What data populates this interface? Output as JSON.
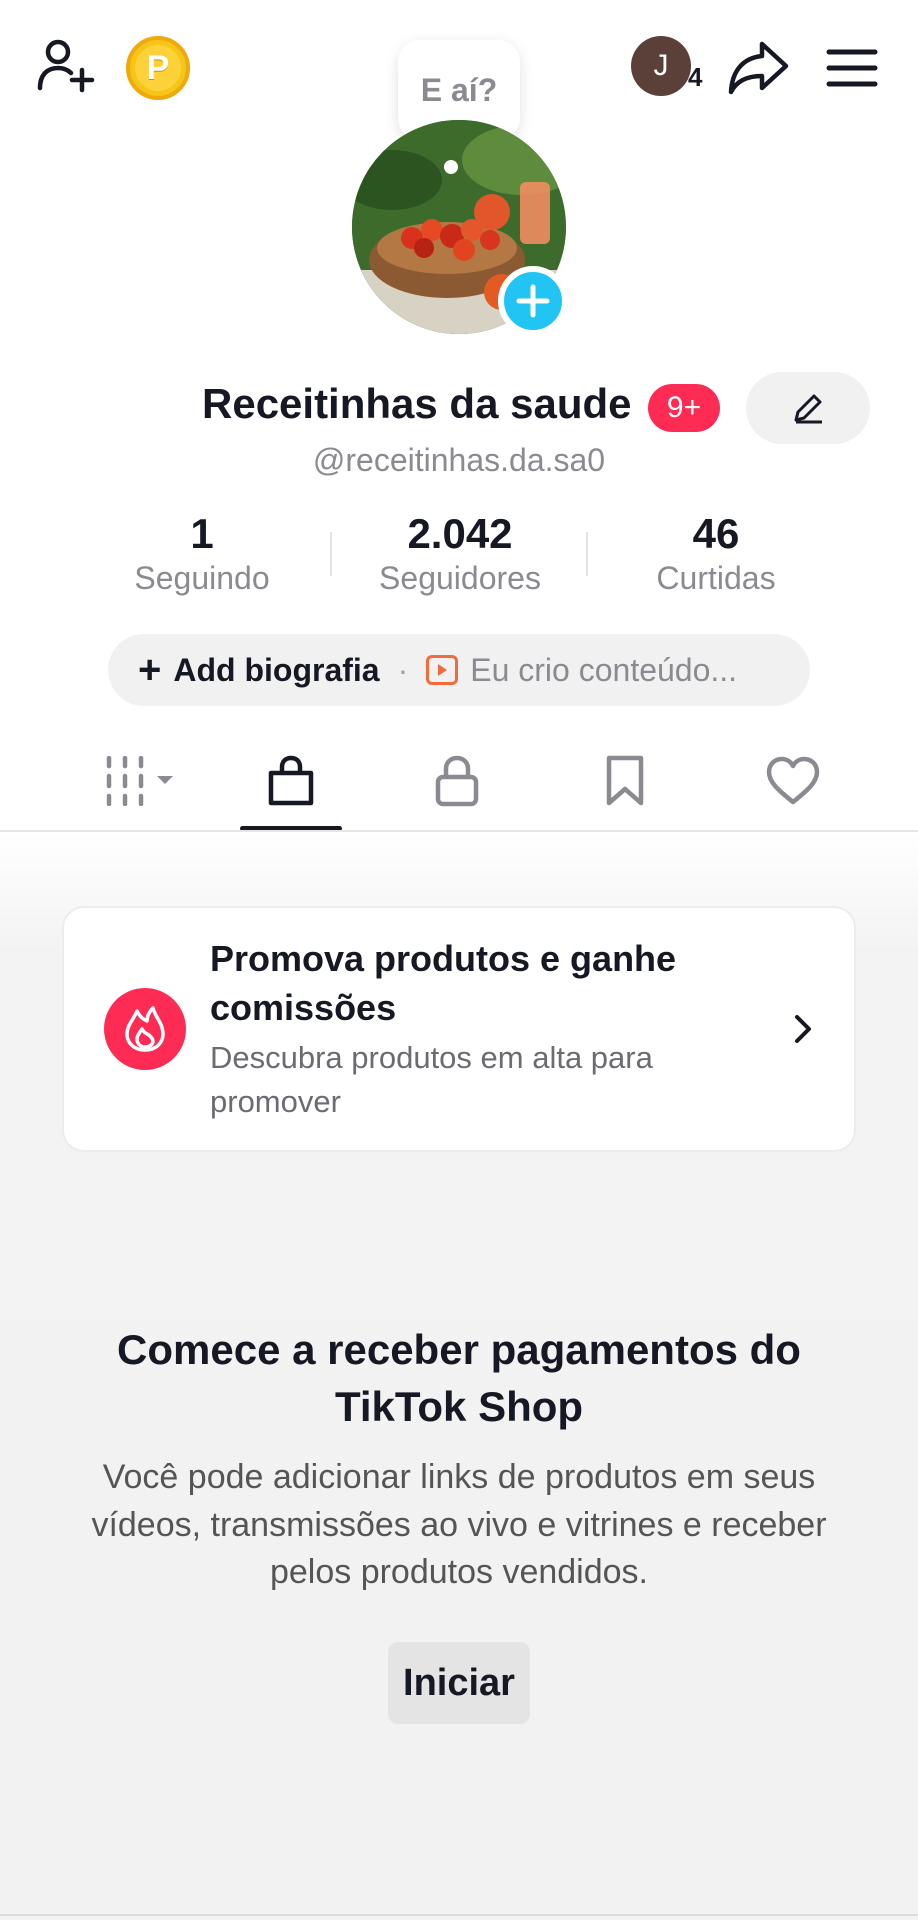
{
  "header": {
    "bubble_text": "E aí?",
    "coin_letter": "P",
    "avatar_letter": "J",
    "avatar_count": "4"
  },
  "profile": {
    "display_name": "Receitinhas da saude",
    "badge": "9+",
    "username": "@receitinhas.da.sa0"
  },
  "stats": {
    "following": {
      "value": "1",
      "label": "Seguindo"
    },
    "followers": {
      "value": "2.042",
      "label": "Seguidores"
    },
    "likes": {
      "value": "46",
      "label": "Curtidas"
    }
  },
  "bio": {
    "add_label": "Add biografia",
    "separator": "·",
    "creator_label": "Eu crio conteúdo..."
  },
  "tabs": [
    "videos",
    "shop",
    "private",
    "saved",
    "liked"
  ],
  "active_tab": "shop",
  "promo": {
    "title": "Promova produtos e ganhe comissões",
    "subtitle": "Descubra produtos em alta para promover"
  },
  "shop": {
    "title": "Comece a receber pagamentos do TikTok Shop",
    "description": "Você pode adicionar links de produtos em seus vídeos, transmissões ao vivo e vitrines e receber pelos produtos vendidos.",
    "button_label": "Iniciar"
  },
  "colors": {
    "accent": "#fe2c55",
    "add_photo": "#21c4f3",
    "coin": "#f5c518"
  }
}
